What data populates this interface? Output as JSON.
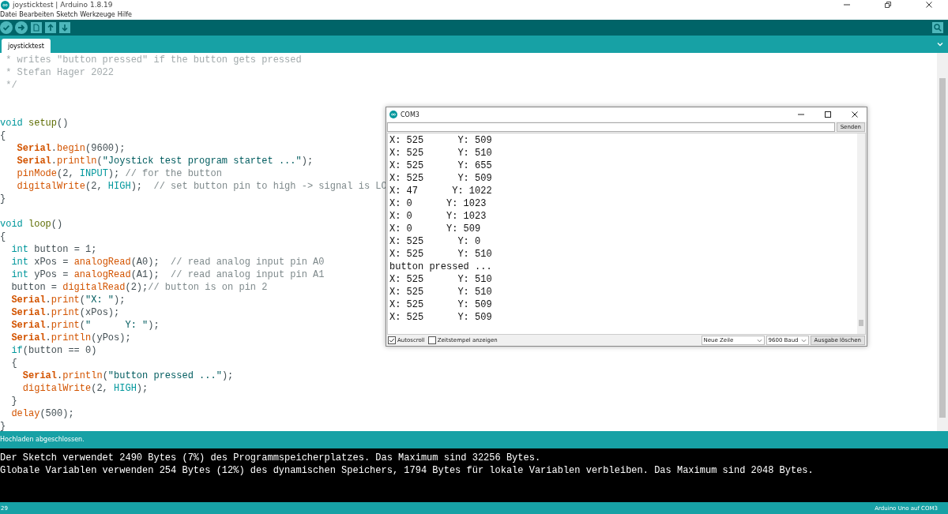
{
  "window": {
    "title": "joysticktest | Arduino 1.8.19"
  },
  "menu": [
    "Datei",
    "Bearbeiten",
    "Sketch",
    "Werkzeuge",
    "Hilfe"
  ],
  "tabs": [
    {
      "label": "joysticktest",
      "selected": true
    }
  ],
  "code_lines": [
    {
      "kind": "code",
      "tokens": [
        {
          "kind": "doc",
          "t": " * writes \"button pressed\" if the button gets pressed"
        }
      ]
    },
    {
      "kind": "code",
      "tokens": [
        {
          "kind": "doc",
          "t": " * Stefan Hager 2022"
        }
      ]
    },
    {
      "kind": "code",
      "tokens": [
        {
          "kind": "doc",
          "t": " */"
        }
      ]
    },
    {
      "kind": "blank"
    },
    {
      "kind": "blank"
    },
    {
      "kind": "code",
      "tokens": [
        {
          "kind": "type",
          "t": "void"
        },
        {
          "kind": "fn",
          "t": " setup"
        },
        {
          "kind": "plain",
          "t": "()"
        }
      ]
    },
    {
      "kind": "code",
      "tokens": [
        {
          "kind": "plain",
          "t": "{"
        }
      ]
    },
    {
      "kind": "code",
      "tokens": [
        {
          "kind": "serial",
          "t": "   Serial"
        },
        {
          "kind": "plain",
          "t": "."
        },
        {
          "kind": "func",
          "t": "begin"
        },
        {
          "kind": "plain",
          "t": "(9600);"
        }
      ]
    },
    {
      "kind": "code",
      "tokens": [
        {
          "kind": "serial",
          "t": "   Serial"
        },
        {
          "kind": "plain",
          "t": "."
        },
        {
          "kind": "func",
          "t": "println"
        },
        {
          "kind": "plain",
          "t": "("
        },
        {
          "kind": "string",
          "t": "\"Joystick test program startet ...\""
        },
        {
          "kind": "plain",
          "t": ");"
        }
      ]
    },
    {
      "kind": "code",
      "tokens": [
        {
          "kind": "func",
          "t": "   pinMode"
        },
        {
          "kind": "plain",
          "t": "(2, "
        },
        {
          "kind": "const",
          "t": "INPUT"
        },
        {
          "kind": "plain",
          "t": "); "
        },
        {
          "kind": "comment",
          "t": "// for the button"
        }
      ]
    },
    {
      "kind": "code",
      "tokens": [
        {
          "kind": "func",
          "t": "   digitalWrite"
        },
        {
          "kind": "plain",
          "t": "(2, "
        },
        {
          "kind": "const",
          "t": "HIGH"
        },
        {
          "kind": "plain",
          "t": ");  "
        },
        {
          "kind": "comment",
          "t": "// set button pin to high -> signal is LO"
        }
      ]
    },
    {
      "kind": "code",
      "tokens": [
        {
          "kind": "plain",
          "t": "}"
        }
      ]
    },
    {
      "kind": "blank"
    },
    {
      "kind": "code",
      "tokens": [
        {
          "kind": "type",
          "t": "void"
        },
        {
          "kind": "fn",
          "t": " loop"
        },
        {
          "kind": "plain",
          "t": "()"
        }
      ]
    },
    {
      "kind": "code",
      "tokens": [
        {
          "kind": "plain",
          "t": "{"
        }
      ]
    },
    {
      "kind": "code",
      "tokens": [
        {
          "kind": "type",
          "t": "  int"
        },
        {
          "kind": "plain",
          "t": " button = 1;"
        }
      ]
    },
    {
      "kind": "code",
      "tokens": [
        {
          "kind": "type",
          "t": "  int"
        },
        {
          "kind": "plain",
          "t": " xPos = "
        },
        {
          "kind": "func",
          "t": "analogRead"
        },
        {
          "kind": "plain",
          "t": "(A0);  "
        },
        {
          "kind": "comment",
          "t": "// read analog input pin A0"
        }
      ]
    },
    {
      "kind": "code",
      "tokens": [
        {
          "kind": "type",
          "t": "  int"
        },
        {
          "kind": "plain",
          "t": " yPos = "
        },
        {
          "kind": "func",
          "t": "analogRead"
        },
        {
          "kind": "plain",
          "t": "(A1);  "
        },
        {
          "kind": "comment",
          "t": "// read analog input pin A1"
        }
      ]
    },
    {
      "kind": "code",
      "tokens": [
        {
          "kind": "plain",
          "t": "  button = "
        },
        {
          "kind": "func",
          "t": "digitalRead"
        },
        {
          "kind": "plain",
          "t": "(2);"
        },
        {
          "kind": "comment",
          "t": "// button is on pin 2"
        }
      ]
    },
    {
      "kind": "code",
      "tokens": [
        {
          "kind": "serial",
          "t": "  Serial"
        },
        {
          "kind": "plain",
          "t": "."
        },
        {
          "kind": "func",
          "t": "print"
        },
        {
          "kind": "plain",
          "t": "("
        },
        {
          "kind": "string",
          "t": "\"X: \""
        },
        {
          "kind": "plain",
          "t": ");"
        }
      ]
    },
    {
      "kind": "code",
      "tokens": [
        {
          "kind": "serial",
          "t": "  Serial"
        },
        {
          "kind": "plain",
          "t": "."
        },
        {
          "kind": "func",
          "t": "print"
        },
        {
          "kind": "plain",
          "t": "(xPos);"
        }
      ]
    },
    {
      "kind": "code",
      "tokens": [
        {
          "kind": "serial",
          "t": "  Serial"
        },
        {
          "kind": "plain",
          "t": "."
        },
        {
          "kind": "func",
          "t": "print"
        },
        {
          "kind": "plain",
          "t": "("
        },
        {
          "kind": "string",
          "t": "\"      Y: \""
        },
        {
          "kind": "plain",
          "t": ");"
        }
      ]
    },
    {
      "kind": "code",
      "tokens": [
        {
          "kind": "serial",
          "t": "  Serial"
        },
        {
          "kind": "plain",
          "t": "."
        },
        {
          "kind": "func",
          "t": "println"
        },
        {
          "kind": "plain",
          "t": "(yPos);"
        }
      ]
    },
    {
      "kind": "code",
      "tokens": [
        {
          "kind": "type",
          "t": "  if"
        },
        {
          "kind": "plain",
          "t": "(button == 0)"
        }
      ]
    },
    {
      "kind": "code",
      "tokens": [
        {
          "kind": "plain",
          "t": "  {"
        }
      ]
    },
    {
      "kind": "code",
      "tokens": [
        {
          "kind": "serial",
          "t": "    Serial"
        },
        {
          "kind": "plain",
          "t": "."
        },
        {
          "kind": "func",
          "t": "println"
        },
        {
          "kind": "plain",
          "t": "("
        },
        {
          "kind": "string",
          "t": "\"button pressed ...\""
        },
        {
          "kind": "plain",
          "t": ");"
        }
      ]
    },
    {
      "kind": "code",
      "tokens": [
        {
          "kind": "func",
          "t": "    digitalWrite"
        },
        {
          "kind": "plain",
          "t": "(2, "
        },
        {
          "kind": "const",
          "t": "HIGH"
        },
        {
          "kind": "plain",
          "t": ");"
        }
      ]
    },
    {
      "kind": "code",
      "tokens": [
        {
          "kind": "plain",
          "t": "  }"
        }
      ]
    },
    {
      "kind": "code",
      "tokens": [
        {
          "kind": "func",
          "t": "  delay"
        },
        {
          "kind": "plain",
          "t": "(500);"
        }
      ]
    },
    {
      "kind": "code",
      "tokens": [
        {
          "kind": "plain",
          "t": "}"
        }
      ]
    }
  ],
  "status_message": "Hochladen abgeschlossen.",
  "console_lines": [
    "Der Sketch verwendet 2490 Bytes (7%) des Programmspeicherplatzes. Das Maximum sind 32256 Bytes.",
    "Globale Variablen verwenden 254 Bytes (12%) des dynamischen Speichers, 1794 Bytes für lokale Variablen verbleiben. Das Maximum sind 2048 Bytes."
  ],
  "status_bar": {
    "line": "29",
    "board": "Arduino Uno auf COM3"
  },
  "serial_monitor": {
    "title": "COM3",
    "send_button": "Senden",
    "output": [
      "X: 525      Y: 509",
      "X: 525      Y: 510",
      "X: 525      Y: 655",
      "X: 525      Y: 509",
      "X: 47      Y: 1022",
      "X: 0      Y: 1023",
      "X: 0      Y: 1023",
      "X: 0      Y: 509",
      "X: 525      Y: 0",
      "X: 525      Y: 510",
      "button pressed ...",
      "X: 525      Y: 510",
      "X: 525      Y: 510",
      "X: 525      Y: 509",
      "X: 525      Y: 509"
    ],
    "autoscroll": {
      "label": "Autoscroll",
      "checked": true
    },
    "timestamp": {
      "label": "Zeitstempel anzeigen",
      "checked": false
    },
    "line_ending": "Neue Zeile",
    "baud": "9600 Baud",
    "clear_button": "Ausgabe löschen"
  }
}
